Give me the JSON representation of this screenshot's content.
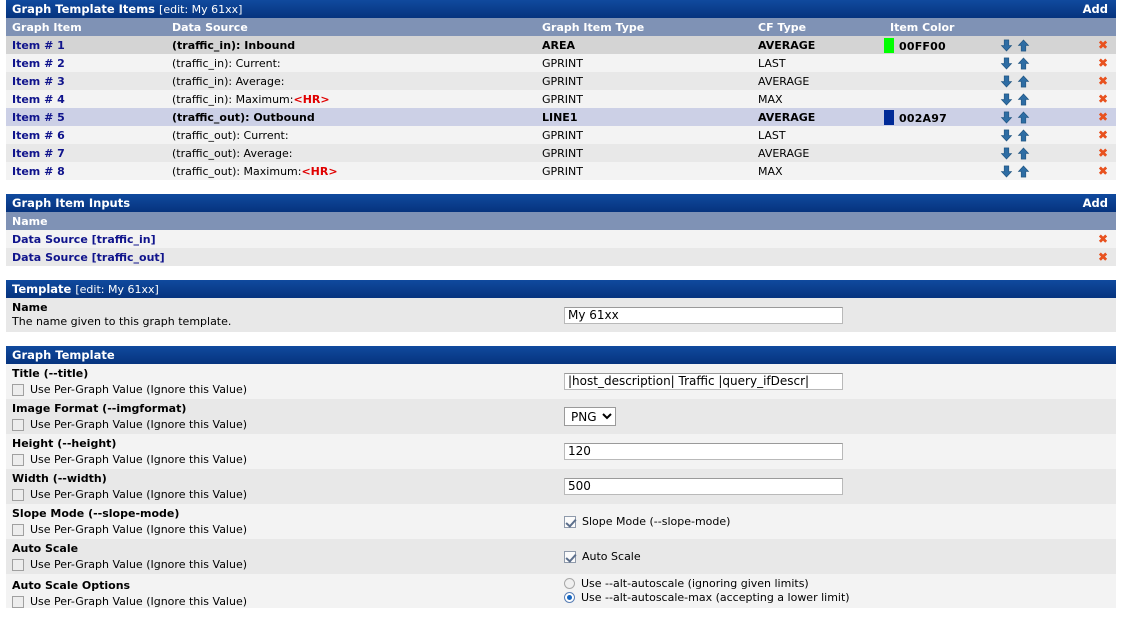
{
  "items_section": {
    "title": "Graph Template Items",
    "title_edit": "[edit: My 61xx]",
    "add_label": "Add",
    "columns": [
      "Graph Item",
      "Data Source",
      "Graph Item Type",
      "CF Type",
      "Item Color"
    ],
    "rows": [
      {
        "item": "Item # 1",
        "data_source": "(traffic_in): Inbound",
        "suffix": "",
        "type": "AREA",
        "cf": "AVERAGE",
        "color_hex": "#00FF00",
        "color_code": "00FF00",
        "highlight": "sel1"
      },
      {
        "item": "Item # 2",
        "data_source": "(traffic_in): Current:",
        "suffix": "",
        "type": "GPRINT",
        "cf": "LAST",
        "color_hex": "",
        "color_code": "",
        "highlight": "a"
      },
      {
        "item": "Item # 3",
        "data_source": "(traffic_in): Average:",
        "suffix": "",
        "type": "GPRINT",
        "cf": "AVERAGE",
        "color_hex": "",
        "color_code": "",
        "highlight": "b"
      },
      {
        "item": "Item # 4",
        "data_source": "(traffic_in): Maximum:",
        "suffix": "<HR>",
        "type": "GPRINT",
        "cf": "MAX",
        "color_hex": "",
        "color_code": "",
        "highlight": "a"
      },
      {
        "item": "Item # 5",
        "data_source": "(traffic_out): Outbound",
        "suffix": "",
        "type": "LINE1",
        "cf": "AVERAGE",
        "color_hex": "#002A97",
        "color_code": "002A97",
        "highlight": "sel2"
      },
      {
        "item": "Item # 6",
        "data_source": "(traffic_out): Current:",
        "suffix": "",
        "type": "GPRINT",
        "cf": "LAST",
        "color_hex": "",
        "color_code": "",
        "highlight": "a"
      },
      {
        "item": "Item # 7",
        "data_source": "(traffic_out): Average:",
        "suffix": "",
        "type": "GPRINT",
        "cf": "AVERAGE",
        "color_hex": "",
        "color_code": "",
        "highlight": "b"
      },
      {
        "item": "Item # 8",
        "data_source": "(traffic_out): Maximum:",
        "suffix": "<HR>",
        "type": "GPRINT",
        "cf": "MAX",
        "color_hex": "",
        "color_code": "",
        "highlight": "a"
      }
    ],
    "move_down_icon": "arrow-down-icon",
    "move_up_icon": "arrow-up-icon",
    "delete_icon": "delete-x-icon",
    "delete_glyph": "✖"
  },
  "inputs_section": {
    "title": "Graph Item Inputs",
    "add_label": "Add",
    "column": "Name",
    "rows": [
      {
        "name": "Data Source [traffic_in]"
      },
      {
        "name": "Data Source [traffic_out]"
      }
    ]
  },
  "template_section": {
    "title": "Template",
    "title_edit": "[edit: My 61xx]",
    "name_label": "Name",
    "name_desc": "The name given to this graph template.",
    "name_value": "My 61xx"
  },
  "graph_template_section": {
    "title": "Graph Template",
    "per_graph_label": "Use Per-Graph Value (Ignore this Value)",
    "fields": [
      {
        "label": "Title (--title)",
        "per_graph_checked": false,
        "control": "text",
        "value": "|host_description| Traffic |query_ifDescr|"
      },
      {
        "label": "Image Format (--imgformat)",
        "per_graph_checked": false,
        "control": "select",
        "value": "PNG",
        "options": [
          "PNG"
        ]
      },
      {
        "label": "Height (--height)",
        "per_graph_checked": false,
        "control": "text",
        "value": "120"
      },
      {
        "label": "Width (--width)",
        "per_graph_checked": false,
        "control": "text",
        "value": "500"
      },
      {
        "label": "Slope Mode (--slope-mode)",
        "per_graph_checked": false,
        "control": "checkbox",
        "checkbox_label": "Slope Mode (--slope-mode)",
        "checked": true
      },
      {
        "label": "Auto Scale",
        "per_graph_checked": false,
        "control": "checkbox",
        "checkbox_label": "Auto Scale",
        "checked": true
      },
      {
        "label": "Auto Scale Options",
        "per_graph_checked": false,
        "control": "radio",
        "options": [
          {
            "label": "Use --alt-autoscale (ignoring given limits)",
            "selected": false
          },
          {
            "label": "Use --alt-autoscale-max (accepting a lower limit)",
            "selected": true
          }
        ]
      }
    ]
  },
  "colors": {
    "title_bar": "#0a3d8f",
    "col_head": "#7f92b5",
    "link": "#10148c",
    "hr_red": "#e00000",
    "delete_x": "#e8521f",
    "arrow_blue": "#2e6da4"
  }
}
